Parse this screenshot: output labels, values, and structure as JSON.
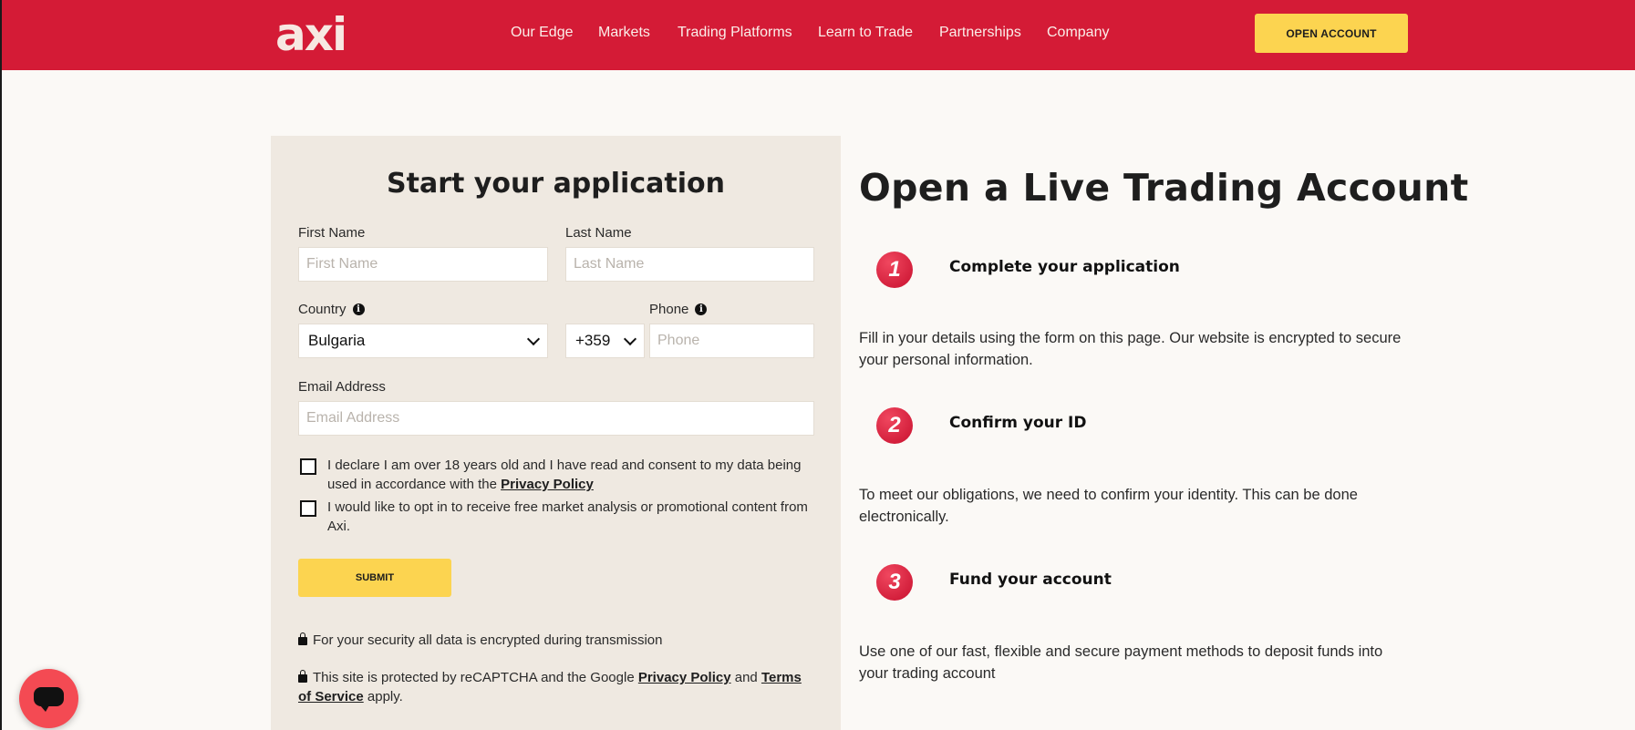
{
  "header": {
    "logo": "axi",
    "nav": [
      "Our Edge",
      "Markets",
      "Trading Platforms",
      "Learn to Trade",
      "Partnerships",
      "Company"
    ],
    "cta": "OPEN ACCOUNT"
  },
  "form": {
    "title": "Start your application",
    "first_name": {
      "label": "First Name",
      "placeholder": "First Name",
      "value": ""
    },
    "last_name": {
      "label": "Last Name",
      "placeholder": "Last Name",
      "value": ""
    },
    "country": {
      "label": "Country",
      "value": "Bulgaria"
    },
    "dial_code": {
      "value": "+359"
    },
    "phone": {
      "label": "Phone",
      "placeholder": "Phone",
      "value": ""
    },
    "email": {
      "label": "Email Address",
      "placeholder": "Email Address",
      "value": ""
    },
    "consent": {
      "text": "I declare I am over 18 years old and I have read and consent to my data being used in accordance with the",
      "link": "Privacy Policy",
      "checked": false
    },
    "marketing": {
      "text": "I would like to opt in to receive free market analysis or promotional content from Axi.",
      "checked": false
    },
    "submit": "SUBMIT",
    "security_note": "For your security all data is encrypted during transmission",
    "recaptcha": {
      "prefix": "This site is protected by reCAPTCHA and the Google",
      "privacy": "Privacy Policy",
      "and": "and",
      "terms": "Terms of Service",
      "suffix": "apply."
    }
  },
  "info": {
    "title": "Open a Live Trading Account",
    "steps": [
      {
        "num": "1",
        "title": "Complete your application",
        "desc": "Fill in your details using the form on this page. Our website is encrypted to secure your personal information."
      },
      {
        "num": "2",
        "title": "Confirm your ID",
        "desc": "To meet our obligations, we need to confirm your identity. This can be done electronically."
      },
      {
        "num": "3",
        "title": "Fund your account",
        "desc": "Use one of our fast, flexible and secure payment methods to deposit funds into your trading account"
      }
    ]
  },
  "colors": {
    "brand": "#d41b36",
    "accent": "#fcd450",
    "panel": "#efe9e1",
    "chat": "#f44a53"
  },
  "icons": {
    "info": "info-icon",
    "dropdown": "chevron-down-icon",
    "lock": "lock-icon",
    "chat": "chat-icon"
  }
}
